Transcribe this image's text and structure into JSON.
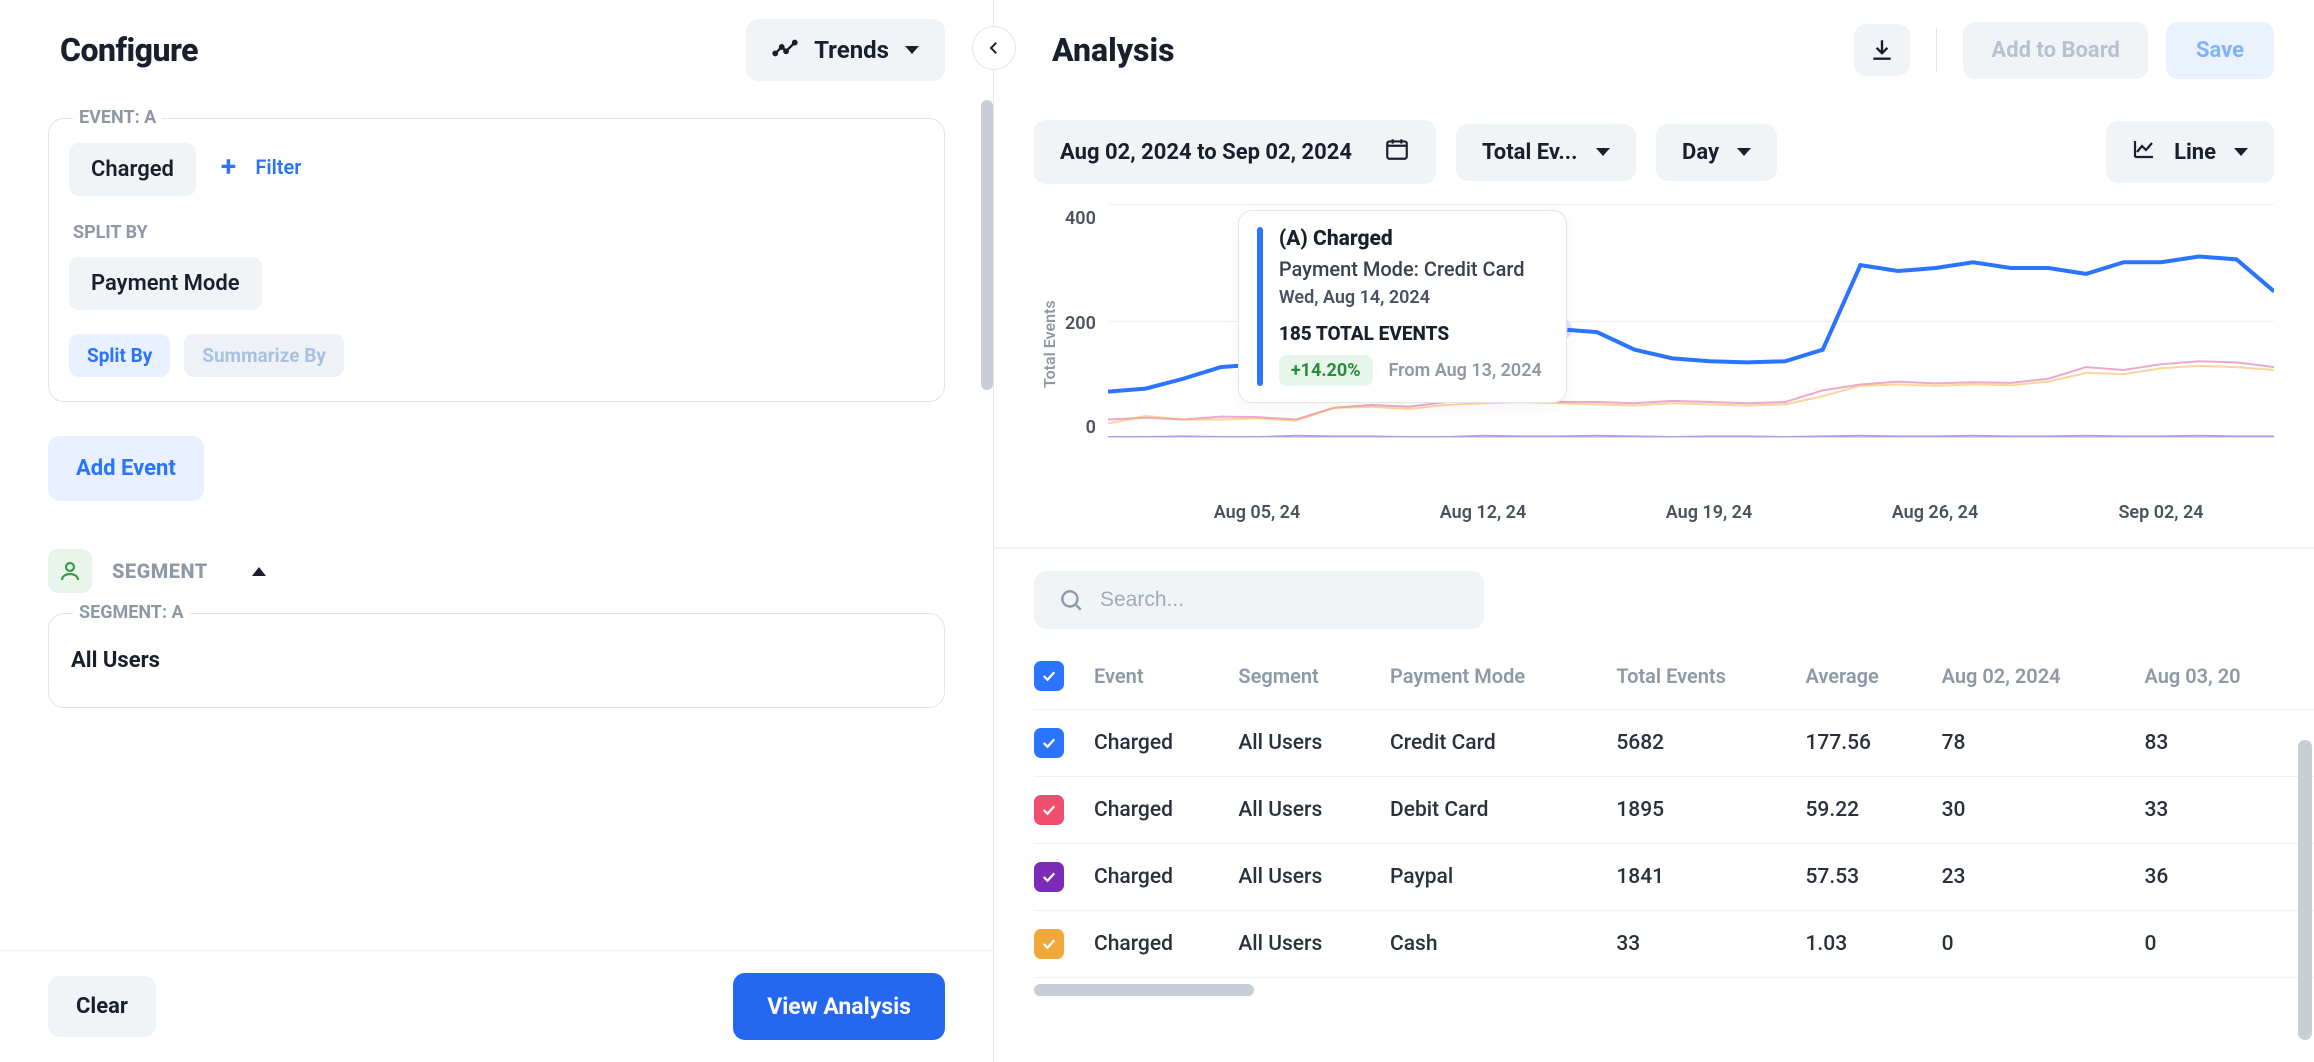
{
  "configure": {
    "title": "Configure",
    "trends_label": "Trends",
    "event_a_label": "EVENT: A",
    "event_chip": "Charged",
    "filter_label": "Filter",
    "split_by_label": "SPLIT BY",
    "split_value": "Payment Mode",
    "split_by_pill": "Split By",
    "summarize_by_pill": "Summarize By",
    "add_event": "Add Event",
    "segment_title": "SEGMENT",
    "segment_a_label": "SEGMENT: A",
    "segment_value": "All Users",
    "clear": "Clear",
    "view_analysis": "View Analysis"
  },
  "analysis": {
    "title": "Analysis",
    "add_to_board": "Add to Board",
    "save": "Save",
    "date_range": "Aug 02, 2024 to Sep 02, 2024",
    "metric": "Total Ev...",
    "granularity": "Day",
    "chart_type": "Line",
    "search_placeholder": "Search..."
  },
  "tooltip": {
    "title": "(A) Charged",
    "subtitle": "Payment Mode: Credit Card",
    "date": "Wed, Aug 14, 2024",
    "total": "185 TOTAL EVENTS",
    "change": "+14.20%",
    "from": "From Aug 13, 2024"
  },
  "chart_data": {
    "type": "line",
    "ylabel": "Total Events",
    "ylim": [
      0,
      400
    ],
    "x_ticks": [
      "Aug 05, 24",
      "Aug 12, 24",
      "Aug 19, 24",
      "Aug 26, 24",
      "Sep 02, 24"
    ],
    "y_ticks": [
      "400",
      "200",
      "0"
    ],
    "categories": [
      "Aug 02",
      "Aug 03",
      "Aug 04",
      "Aug 05",
      "Aug 06",
      "Aug 07",
      "Aug 08",
      "Aug 09",
      "Aug 10",
      "Aug 11",
      "Aug 12",
      "Aug 13",
      "Aug 14",
      "Aug 15",
      "Aug 16",
      "Aug 17",
      "Aug 18",
      "Aug 19",
      "Aug 20",
      "Aug 21",
      "Aug 22",
      "Aug 23",
      "Aug 24",
      "Aug 25",
      "Aug 26",
      "Aug 27",
      "Aug 28",
      "Aug 29",
      "Aug 30",
      "Aug 31",
      "Sep 01",
      "Sep 02"
    ],
    "series": [
      {
        "name": "Credit Card",
        "color": "#2b74ff",
        "values": [
          78,
          83,
          100,
          120,
          125,
          130,
          140,
          155,
          160,
          175,
          178,
          162,
          185,
          180,
          150,
          135,
          130,
          128,
          130,
          150,
          295,
          285,
          290,
          300,
          290,
          290,
          280,
          300,
          300,
          310,
          305,
          250
        ]
      },
      {
        "name": "Debit Card",
        "color": "#e05ea8",
        "values": [
          30,
          33,
          30,
          35,
          34,
          30,
          50,
          55,
          52,
          60,
          62,
          65,
          60,
          60,
          58,
          62,
          60,
          58,
          60,
          80,
          90,
          95,
          92,
          94,
          93,
          100,
          120,
          115,
          125,
          130,
          128,
          120
        ]
      },
      {
        "name": "Paypal",
        "color": "#f6b24a",
        "values": [
          23,
          36,
          30,
          30,
          32,
          28,
          50,
          52,
          48,
          55,
          58,
          60,
          58,
          56,
          54,
          58,
          56,
          54,
          56,
          70,
          88,
          90,
          88,
          90,
          89,
          95,
          110,
          108,
          118,
          122,
          120,
          115
        ]
      },
      {
        "name": "Cash",
        "color": "#7b4bd6",
        "values": [
          0,
          0,
          1,
          0,
          0,
          2,
          1,
          1,
          0,
          0,
          2,
          1,
          1,
          2,
          1,
          0,
          1,
          1,
          0,
          1,
          2,
          1,
          1,
          2,
          1,
          1,
          2,
          1,
          1,
          2,
          1,
          1
        ]
      }
    ],
    "highlight": {
      "series": "Credit Card",
      "index": 12,
      "value": 185
    }
  },
  "table": {
    "columns": [
      "",
      "Event",
      "Segment",
      "Payment Mode",
      "Total Events",
      "Average",
      "Aug 02, 2024",
      "Aug 03, 20"
    ],
    "header_checked": true,
    "rows": [
      {
        "color": "#2b74ff",
        "checked": true,
        "event": "Charged",
        "segment": "All Users",
        "mode": "Credit Card",
        "total": "5682",
        "avg": "177.56",
        "d1": "78",
        "d2": "83"
      },
      {
        "color": "#ef4e6f",
        "checked": true,
        "event": "Charged",
        "segment": "All Users",
        "mode": "Debit Card",
        "total": "1895",
        "avg": "59.22",
        "d1": "30",
        "d2": "33"
      },
      {
        "color": "#7b2bb6",
        "checked": true,
        "event": "Charged",
        "segment": "All Users",
        "mode": "Paypal",
        "total": "1841",
        "avg": "57.53",
        "d1": "23",
        "d2": "36"
      },
      {
        "color": "#f2a93b",
        "checked": true,
        "event": "Charged",
        "segment": "All Users",
        "mode": "Cash",
        "total": "33",
        "avg": "1.03",
        "d1": "0",
        "d2": "0"
      }
    ]
  }
}
